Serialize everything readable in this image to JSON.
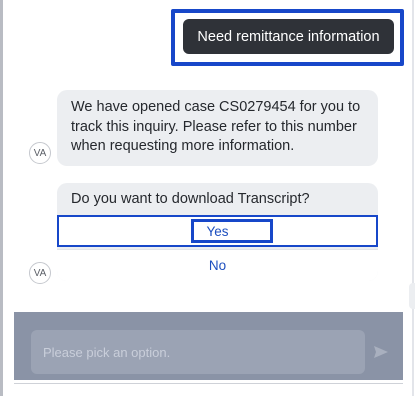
{
  "user_message": {
    "text": "Need remittance information"
  },
  "bot_message": {
    "lines": [
      "We have opened case CS0279454 for you to",
      "track this inquiry. Please refer to this number",
      "when requesting more information."
    ]
  },
  "avatar": {
    "label": "VA"
  },
  "prompt_card": {
    "question": "Do you want to download Transcript?",
    "options": [
      "Yes",
      "No"
    ]
  },
  "composer": {
    "placeholder": "Please pick an option."
  },
  "icons": {
    "send": "send-arrow-icon"
  },
  "colors": {
    "highlight": "#1747c9",
    "user_bubble": "#2f3238",
    "link": "#1d4fbf"
  }
}
